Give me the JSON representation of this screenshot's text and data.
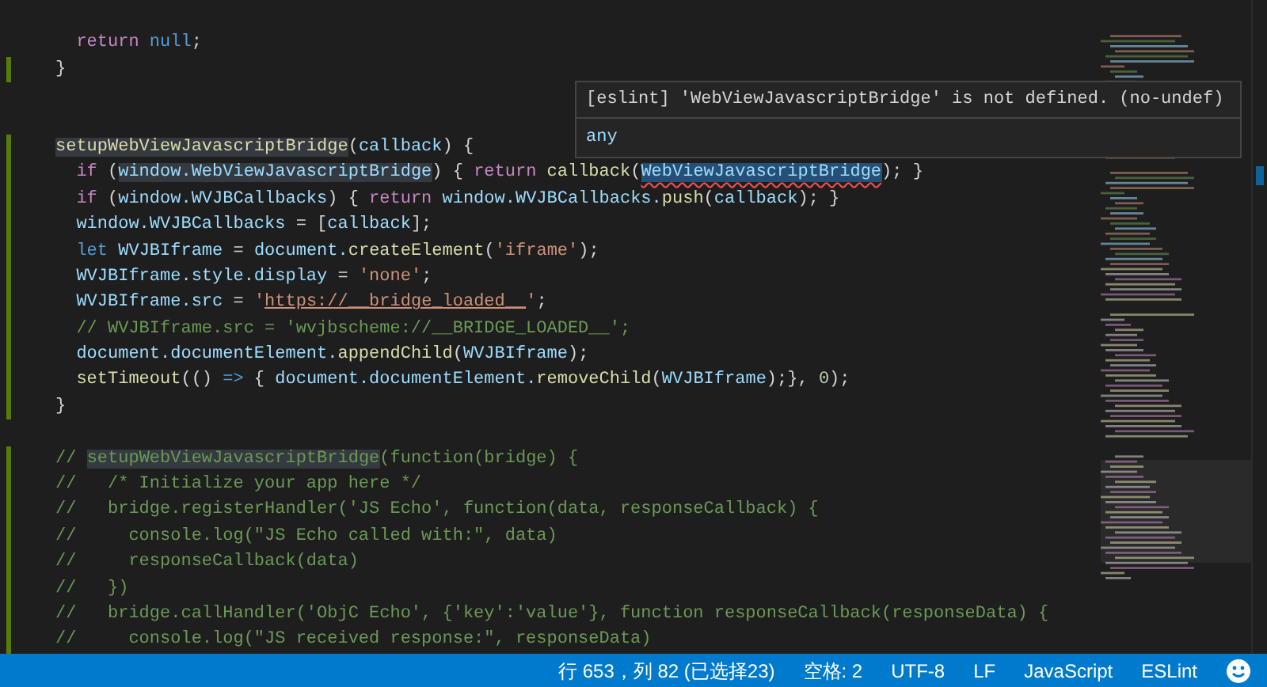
{
  "editor": {
    "lines": [
      {
        "changed": false
      },
      {
        "changed": false,
        "tokens": [
          {
            "text": "  return",
            "kind": "keyword"
          },
          {
            "text": " null",
            "kind": "constant"
          },
          {
            "text": ";"
          }
        ]
      },
      {
        "changed": true,
        "tokens": [
          {
            "text": "}"
          }
        ]
      },
      {
        "changed": false
      },
      {
        "changed": false
      },
      {
        "changed": true,
        "tokens": [
          {
            "text": "setupWebViewJavascriptBridge",
            "kind": "function",
            "highlight": true
          },
          {
            "text": "("
          },
          {
            "text": "callback",
            "kind": "variable"
          },
          {
            "text": ") {"
          }
        ]
      },
      {
        "changed": true,
        "tokens": [
          {
            "text": "  if",
            "kind": "keyword"
          },
          {
            "text": " ("
          },
          {
            "text": "window.WebViewJavascriptBridge",
            "kind": "variable",
            "highlight": true
          },
          {
            "text": ") { "
          },
          {
            "text": "return",
            "kind": "keyword"
          },
          {
            "text": " callback",
            "kind": "function"
          },
          {
            "text": "("
          },
          {
            "text": "WebViewJavascriptBridge",
            "kind": "variable",
            "selected": true,
            "error": true
          },
          {
            "text": "); }"
          }
        ]
      },
      {
        "changed": true,
        "tokens": [
          {
            "text": "  if",
            "kind": "keyword"
          },
          {
            "text": " ("
          },
          {
            "text": "window.WVJBCallbacks",
            "kind": "variable"
          },
          {
            "text": ") { "
          },
          {
            "text": "return",
            "kind": "keyword"
          },
          {
            "text": " window.WVJBCallbacks.",
            "kind": "variable"
          },
          {
            "text": "push",
            "kind": "function"
          },
          {
            "text": "("
          },
          {
            "text": "callback",
            "kind": "variable"
          },
          {
            "text": "); }"
          }
        ]
      },
      {
        "changed": true,
        "tokens": [
          {
            "text": "  window.WVJBCallbacks",
            "kind": "variable"
          },
          {
            "text": " = ["
          },
          {
            "text": "callback",
            "kind": "variable"
          },
          {
            "text": "];"
          }
        ]
      },
      {
        "changed": true,
        "tokens": [
          {
            "text": "  let",
            "kind": "storage"
          },
          {
            "text": " WVJBIframe",
            "kind": "variable"
          },
          {
            "text": " = "
          },
          {
            "text": "document.",
            "kind": "variable"
          },
          {
            "text": "createElement",
            "kind": "function"
          },
          {
            "text": "("
          },
          {
            "text": "'iframe'",
            "kind": "string"
          },
          {
            "text": ");"
          }
        ]
      },
      {
        "changed": true,
        "tokens": [
          {
            "text": "  WVJBIframe.style.display",
            "kind": "variable"
          },
          {
            "text": " = "
          },
          {
            "text": "'none'",
            "kind": "string"
          },
          {
            "text": ";"
          }
        ]
      },
      {
        "changed": true,
        "tokens": [
          {
            "text": "  WVJBIframe.src",
            "kind": "variable"
          },
          {
            "text": " = "
          },
          {
            "text": "'",
            "kind": "string"
          },
          {
            "text": "https://__bridge_loaded__",
            "kind": "link"
          },
          {
            "text": "'",
            "kind": "string"
          },
          {
            "text": ";"
          }
        ]
      },
      {
        "changed": true,
        "tokens": [
          {
            "text": "  // WVJBIframe.src = 'wvjbscheme://__BRIDGE_LOADED__';",
            "kind": "comment"
          }
        ]
      },
      {
        "changed": true,
        "tokens": [
          {
            "text": "  document.documentElement.",
            "kind": "variable"
          },
          {
            "text": "appendChild",
            "kind": "function"
          },
          {
            "text": "("
          },
          {
            "text": "WVJBIframe",
            "kind": "variable"
          },
          {
            "text": ");"
          }
        ]
      },
      {
        "changed": true,
        "tokens": [
          {
            "text": "  setTimeout",
            "kind": "function"
          },
          {
            "text": "(() "
          },
          {
            "text": "=>",
            "kind": "storage"
          },
          {
            "text": " { "
          },
          {
            "text": "document.documentElement.",
            "kind": "variable"
          },
          {
            "text": "removeChild",
            "kind": "function"
          },
          {
            "text": "("
          },
          {
            "text": "WVJBIframe",
            "kind": "variable"
          },
          {
            "text": ");}, "
          },
          {
            "text": "0",
            "kind": "number"
          },
          {
            "text": ");"
          }
        ]
      },
      {
        "changed": true,
        "tokens": [
          {
            "text": "}"
          }
        ]
      },
      {
        "changed": false
      },
      {
        "changed": true,
        "tokens": [
          {
            "text": "// ",
            "kind": "comment"
          },
          {
            "text": "setupWebViewJavascriptBridge",
            "kind": "comment",
            "highlight": true
          },
          {
            "text": "(function(bridge) {",
            "kind": "comment"
          }
        ]
      },
      {
        "changed": true,
        "tokens": [
          {
            "text": "//   /* Initialize your app here */",
            "kind": "comment"
          }
        ]
      },
      {
        "changed": true,
        "tokens": [
          {
            "text": "//   bridge.registerHandler('JS Echo', function(data, responseCallback) {",
            "kind": "comment"
          }
        ]
      },
      {
        "changed": true,
        "tokens": [
          {
            "text": "//     console.log(\"JS Echo called with:\", data)",
            "kind": "comment"
          }
        ]
      },
      {
        "changed": true,
        "tokens": [
          {
            "text": "//     responseCallback(data)",
            "kind": "comment"
          }
        ]
      },
      {
        "changed": true,
        "tokens": [
          {
            "text": "//   })",
            "kind": "comment"
          }
        ]
      },
      {
        "changed": true,
        "tokens": [
          {
            "text": "//   bridge.callHandler('ObjC Echo', {'key':'value'}, function responseCallback(responseData) {",
            "kind": "comment"
          }
        ]
      },
      {
        "changed": true,
        "tokens": [
          {
            "text": "//     console.log(\"JS received response:\", responseData)",
            "kind": "comment"
          }
        ]
      }
    ]
  },
  "hover": {
    "message": "[eslint] 'WebViewJavascriptBridge' is not defined. (no-undef)",
    "type": "any"
  },
  "status_bar": {
    "items": [
      "行 653，列 82 (已选择23)",
      "空格: 2",
      "UTF-8",
      "LF",
      "JavaScript",
      "ESLint"
    ]
  }
}
